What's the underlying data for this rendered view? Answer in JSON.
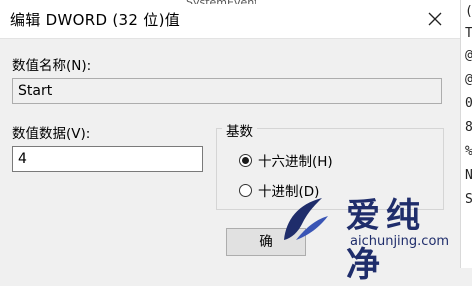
{
  "dialog": {
    "title": "编辑 DWORD (32 位)值",
    "value_name_label": "数值名称(N):",
    "value_name": "Start",
    "value_data_label": "数值数据(V):",
    "value_data": "4",
    "base": {
      "title": "基数",
      "options": [
        {
          "label": "十六进制(H)",
          "selected": true
        },
        {
          "label": "十进制(D)",
          "selected": false
        }
      ]
    },
    "ok_label": "确"
  },
  "background": {
    "right_column_chars": [
      "(",
      "T",
      "@",
      "@",
      "0",
      "8",
      "%",
      "N",
      "S"
    ]
  },
  "watermark": {
    "main": "爱纯净",
    "sub": "aichunjing.com",
    "color": "#1f2d6b"
  }
}
